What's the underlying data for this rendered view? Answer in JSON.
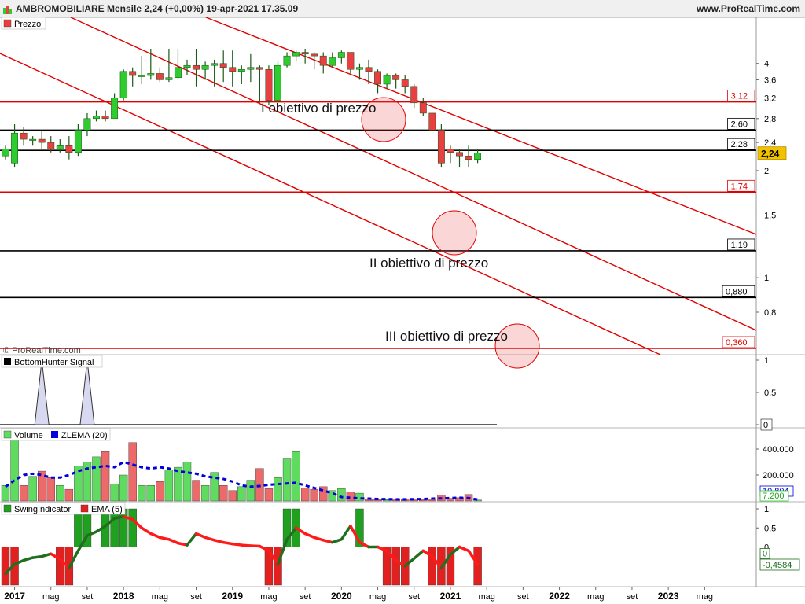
{
  "title": "AMBROMOBILIARE Mensile 2,24 (+0,00%) 19-apr-2021 17.35.09",
  "website": "www.ProRealTime.com",
  "watermark": "© ProRealTime.com",
  "icons": {
    "app": "chart-app-icon",
    "legend": "legend-swatch-icon"
  },
  "colors": {
    "up": "#2ecc2e",
    "down": "#e84040",
    "trend": "#e00000",
    "level": "#000000",
    "zlema": "#0000dd",
    "price_badge": "#f2c200"
  },
  "x_axis": {
    "ticks": [
      "2017",
      "mag",
      "set",
      "2018",
      "mag",
      "set",
      "2019",
      "mag",
      "set",
      "2020",
      "mag",
      "set",
      "2021",
      "mag",
      "set",
      "2022",
      "mag",
      "set",
      "2023",
      "mag"
    ]
  },
  "price_panel": {
    "legend": "Prezzo",
    "y_ticks": [
      "4",
      "3,6",
      "3,2",
      "2,8",
      "2,4",
      "2",
      "1,5",
      "1",
      "0,8"
    ],
    "current_price": "2,24",
    "levels": [
      {
        "label": "3,12",
        "value": 3.12,
        "color": "red"
      },
      {
        "label": "2,60",
        "value": 2.6,
        "color": "black"
      },
      {
        "label": "2,28",
        "value": 2.28,
        "color": "black"
      },
      {
        "label": "1,74",
        "value": 1.74,
        "color": "red"
      },
      {
        "label": "1,19",
        "value": 1.19,
        "color": "black"
      },
      {
        "label": "0,880",
        "value": 0.88,
        "color": "black"
      },
      {
        "label": "0,360",
        "value": 0.36,
        "color": "red"
      }
    ],
    "annotations": [
      "I obiettivo di prezzo",
      "II obiettivo di prezzo",
      "III obiettivo di prezzo"
    ]
  },
  "bottomhunter_panel": {
    "legend": "BottomHunter Signal",
    "y_ticks": [
      "1",
      "0,5",
      "0"
    ]
  },
  "volume_panel": {
    "legend_volume": "Volume",
    "legend_zlema": "ZLEMA (20)",
    "y_ticks": [
      "400.000",
      "200.000"
    ],
    "badge_top": "10.804",
    "badge_bottom": "7.200"
  },
  "swing_panel": {
    "legend_swing": "SwingIndicator",
    "legend_ema": "EMA (5)",
    "y_ticks": [
      "1",
      "0,5",
      "0"
    ],
    "badge_zero": "0",
    "badge_ema": "-0,4584"
  },
  "chart_data": {
    "type": "candlestick",
    "title": "AMBROMOBILIARE Mensile",
    "period": "monthly",
    "x": [
      "2016-12",
      "2017-01",
      "2017-02",
      "2017-03",
      "2017-04",
      "2017-05",
      "2017-06",
      "2017-07",
      "2017-08",
      "2017-09",
      "2017-10",
      "2017-11",
      "2017-12",
      "2018-01",
      "2018-02",
      "2018-03",
      "2018-04",
      "2018-05",
      "2018-06",
      "2018-07",
      "2018-08",
      "2018-09",
      "2018-10",
      "2018-11",
      "2018-12",
      "2019-01",
      "2019-02",
      "2019-03",
      "2019-04",
      "2019-05",
      "2019-06",
      "2019-07",
      "2019-08",
      "2019-09",
      "2019-10",
      "2019-11",
      "2019-12",
      "2020-01",
      "2020-02",
      "2020-03",
      "2020-04",
      "2020-05",
      "2020-06",
      "2020-07",
      "2020-08",
      "2020-09",
      "2020-10",
      "2020-11",
      "2020-12",
      "2021-01",
      "2021-02",
      "2021-03",
      "2021-04"
    ],
    "open": [
      2.2,
      2.1,
      2.55,
      2.45,
      2.45,
      2.4,
      2.3,
      2.35,
      2.25,
      2.6,
      2.8,
      2.85,
      2.8,
      3.2,
      3.8,
      3.7,
      3.7,
      3.75,
      3.6,
      3.65,
      3.9,
      3.95,
      3.85,
      3.95,
      4.0,
      3.9,
      3.8,
      3.85,
      3.9,
      3.85,
      3.15,
      3.95,
      4.2,
      4.3,
      4.25,
      4.2,
      3.95,
      4.15,
      4.3,
      3.85,
      3.9,
      3.8,
      3.5,
      3.7,
      3.6,
      3.45,
      3.1,
      2.9,
      2.6,
      2.3,
      2.25,
      2.2,
      2.15
    ],
    "close": [
      2.3,
      2.55,
      2.45,
      2.45,
      2.4,
      2.3,
      2.35,
      2.25,
      2.6,
      2.8,
      2.85,
      2.8,
      3.2,
      3.8,
      3.7,
      3.7,
      3.75,
      3.6,
      3.65,
      3.9,
      3.95,
      3.85,
      3.95,
      4.0,
      3.9,
      3.8,
      3.85,
      3.9,
      3.85,
      3.15,
      3.95,
      4.2,
      4.3,
      4.25,
      4.2,
      3.95,
      4.15,
      4.3,
      3.85,
      3.9,
      3.8,
      3.5,
      3.7,
      3.6,
      3.45,
      3.1,
      2.9,
      2.6,
      2.1,
      2.25,
      2.2,
      2.15,
      2.24
    ],
    "high": [
      2.35,
      2.7,
      2.65,
      2.5,
      2.6,
      2.5,
      2.45,
      2.5,
      2.7,
      2.9,
      2.95,
      2.95,
      3.3,
      3.85,
      3.9,
      4.2,
      4.4,
      3.9,
      4.4,
      4.4,
      4.1,
      4.4,
      4.05,
      4.1,
      4.35,
      4.35,
      3.95,
      4.25,
      3.95,
      3.95,
      4.05,
      4.3,
      4.35,
      4.4,
      4.3,
      4.3,
      4.3,
      4.35,
      4.3,
      4.0,
      4.1,
      3.85,
      3.75,
      3.75,
      3.7,
      3.5,
      3.2,
      2.9,
      2.7,
      2.35,
      2.3,
      2.35,
      2.3
    ],
    "low": [
      2.15,
      2.05,
      2.35,
      2.35,
      2.3,
      2.25,
      2.25,
      2.15,
      2.2,
      2.5,
      2.75,
      2.75,
      2.8,
      3.15,
      3.45,
      3.5,
      3.6,
      3.55,
      3.55,
      3.6,
      3.7,
      3.45,
      3.6,
      3.45,
      3.55,
      3.45,
      3.5,
      3.55,
      3.1,
      3.05,
      3.1,
      3.9,
      4.05,
      4.0,
      3.85,
      3.75,
      3.9,
      4.0,
      3.75,
      3.6,
      3.5,
      3.3,
      3.4,
      3.4,
      3.3,
      3.0,
      2.85,
      2.6,
      2.05,
      2.1,
      2.05,
      2.05,
      2.1
    ],
    "y_scale": "log",
    "ylim": [
      0.8,
      4.4
    ],
    "horizontal_levels": [
      3.12,
      2.6,
      2.28,
      1.74,
      1.19,
      0.88,
      0.36
    ],
    "volume": [
      120000,
      480000,
      120000,
      190000,
      230000,
      180000,
      120000,
      90000,
      270000,
      300000,
      340000,
      380000,
      130000,
      200000,
      450000,
      120000,
      120000,
      150000,
      240000,
      260000,
      300000,
      160000,
      120000,
      220000,
      120000,
      80000,
      110000,
      160000,
      250000,
      95000,
      180000,
      330000,
      380000,
      100000,
      90000,
      110000,
      80000,
      95000,
      70000,
      60000,
      15000,
      12000,
      10000,
      15000,
      14000,
      16000,
      12000,
      15000,
      45000,
      20000,
      25000,
      50000,
      7200
    ],
    "zlema": [
      110000,
      160000,
      200000,
      210000,
      200000,
      180000,
      180000,
      200000,
      230000,
      250000,
      260000,
      270000,
      260000,
      300000,
      280000,
      260000,
      250000,
      260000,
      250000,
      230000,
      220000,
      210000,
      190000,
      180000,
      170000,
      150000,
      120000,
      110000,
      115000,
      125000,
      130000,
      135000,
      140000,
      120000,
      100000,
      80000,
      60000,
      30000,
      25000,
      20000,
      18000,
      15000,
      14000,
      13000,
      13000,
      14000,
      15000,
      18000,
      20000,
      22000,
      25000,
      22000,
      10804
    ],
    "bottomhunter_signal": [
      0,
      0,
      0,
      0,
      1,
      0,
      0,
      0,
      0,
      1,
      0,
      0,
      0,
      0,
      0,
      0,
      0,
      0,
      0,
      0,
      0,
      0,
      0,
      0,
      0,
      0,
      0,
      0,
      0,
      0,
      0,
      0,
      0,
      0,
      0,
      0,
      0,
      0,
      0,
      0,
      0,
      0,
      0,
      0,
      0,
      0,
      0,
      0,
      0,
      0,
      0,
      0,
      0
    ],
    "swing": [
      -1,
      -1,
      0,
      0,
      0,
      0,
      -1,
      -1,
      1,
      1,
      0,
      1,
      1,
      1,
      1,
      0,
      0,
      0,
      0,
      0,
      0,
      0,
      0,
      0,
      0,
      0,
      0,
      0,
      0,
      -1,
      -1,
      1,
      1,
      0,
      0,
      0,
      0,
      0,
      0,
      1,
      0,
      0,
      -1,
      -1,
      -1,
      0,
      0,
      -1,
      -1,
      -1,
      0,
      0,
      -1
    ],
    "ema5": [
      -0.7,
      -0.45,
      -0.35,
      -0.28,
      -0.25,
      -0.18,
      -0.32,
      -0.55,
      -0.1,
      0.3,
      0.4,
      0.55,
      0.75,
      0.8,
      0.72,
      0.5,
      0.35,
      0.25,
      0.2,
      0.1,
      0.05,
      0.35,
      0.25,
      0.18,
      0.12,
      0.08,
      0.05,
      0.03,
      0.02,
      -0.1,
      -0.45,
      0.2,
      0.5,
      0.35,
      0.25,
      0.18,
      0.12,
      0.2,
      0.55,
      0.12,
      0.0,
      0.0,
      -0.1,
      -0.35,
      -0.5,
      -0.3,
      -0.1,
      -0.25,
      -0.55,
      -0.2,
      0.0,
      -0.1,
      -0.4584
    ]
  }
}
